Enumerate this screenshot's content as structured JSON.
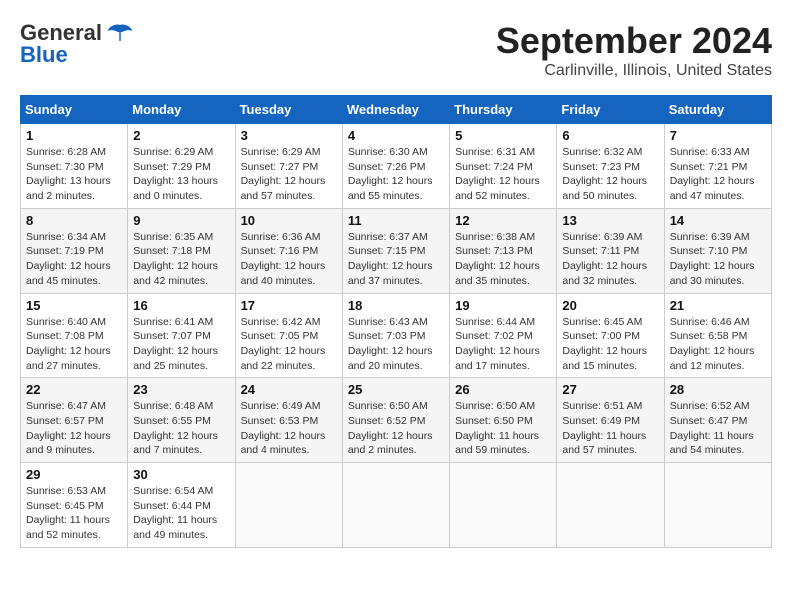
{
  "header": {
    "logo_line1": "General",
    "logo_line2": "Blue",
    "title": "September 2024",
    "subtitle": "Carlinville, Illinois, United States"
  },
  "columns": [
    "Sunday",
    "Monday",
    "Tuesday",
    "Wednesday",
    "Thursday",
    "Friday",
    "Saturday"
  ],
  "weeks": [
    [
      {
        "day": "1",
        "info": "Sunrise: 6:28 AM\nSunset: 7:30 PM\nDaylight: 13 hours\nand 2 minutes."
      },
      {
        "day": "2",
        "info": "Sunrise: 6:29 AM\nSunset: 7:29 PM\nDaylight: 13 hours\nand 0 minutes."
      },
      {
        "day": "3",
        "info": "Sunrise: 6:29 AM\nSunset: 7:27 PM\nDaylight: 12 hours\nand 57 minutes."
      },
      {
        "day": "4",
        "info": "Sunrise: 6:30 AM\nSunset: 7:26 PM\nDaylight: 12 hours\nand 55 minutes."
      },
      {
        "day": "5",
        "info": "Sunrise: 6:31 AM\nSunset: 7:24 PM\nDaylight: 12 hours\nand 52 minutes."
      },
      {
        "day": "6",
        "info": "Sunrise: 6:32 AM\nSunset: 7:23 PM\nDaylight: 12 hours\nand 50 minutes."
      },
      {
        "day": "7",
        "info": "Sunrise: 6:33 AM\nSunset: 7:21 PM\nDaylight: 12 hours\nand 47 minutes."
      }
    ],
    [
      {
        "day": "8",
        "info": "Sunrise: 6:34 AM\nSunset: 7:19 PM\nDaylight: 12 hours\nand 45 minutes."
      },
      {
        "day": "9",
        "info": "Sunrise: 6:35 AM\nSunset: 7:18 PM\nDaylight: 12 hours\nand 42 minutes."
      },
      {
        "day": "10",
        "info": "Sunrise: 6:36 AM\nSunset: 7:16 PM\nDaylight: 12 hours\nand 40 minutes."
      },
      {
        "day": "11",
        "info": "Sunrise: 6:37 AM\nSunset: 7:15 PM\nDaylight: 12 hours\nand 37 minutes."
      },
      {
        "day": "12",
        "info": "Sunrise: 6:38 AM\nSunset: 7:13 PM\nDaylight: 12 hours\nand 35 minutes."
      },
      {
        "day": "13",
        "info": "Sunrise: 6:39 AM\nSunset: 7:11 PM\nDaylight: 12 hours\nand 32 minutes."
      },
      {
        "day": "14",
        "info": "Sunrise: 6:39 AM\nSunset: 7:10 PM\nDaylight: 12 hours\nand 30 minutes."
      }
    ],
    [
      {
        "day": "15",
        "info": "Sunrise: 6:40 AM\nSunset: 7:08 PM\nDaylight: 12 hours\nand 27 minutes."
      },
      {
        "day": "16",
        "info": "Sunrise: 6:41 AM\nSunset: 7:07 PM\nDaylight: 12 hours\nand 25 minutes."
      },
      {
        "day": "17",
        "info": "Sunrise: 6:42 AM\nSunset: 7:05 PM\nDaylight: 12 hours\nand 22 minutes."
      },
      {
        "day": "18",
        "info": "Sunrise: 6:43 AM\nSunset: 7:03 PM\nDaylight: 12 hours\nand 20 minutes."
      },
      {
        "day": "19",
        "info": "Sunrise: 6:44 AM\nSunset: 7:02 PM\nDaylight: 12 hours\nand 17 minutes."
      },
      {
        "day": "20",
        "info": "Sunrise: 6:45 AM\nSunset: 7:00 PM\nDaylight: 12 hours\nand 15 minutes."
      },
      {
        "day": "21",
        "info": "Sunrise: 6:46 AM\nSunset: 6:58 PM\nDaylight: 12 hours\nand 12 minutes."
      }
    ],
    [
      {
        "day": "22",
        "info": "Sunrise: 6:47 AM\nSunset: 6:57 PM\nDaylight: 12 hours\nand 9 minutes."
      },
      {
        "day": "23",
        "info": "Sunrise: 6:48 AM\nSunset: 6:55 PM\nDaylight: 12 hours\nand 7 minutes."
      },
      {
        "day": "24",
        "info": "Sunrise: 6:49 AM\nSunset: 6:53 PM\nDaylight: 12 hours\nand 4 minutes."
      },
      {
        "day": "25",
        "info": "Sunrise: 6:50 AM\nSunset: 6:52 PM\nDaylight: 12 hours\nand 2 minutes."
      },
      {
        "day": "26",
        "info": "Sunrise: 6:50 AM\nSunset: 6:50 PM\nDaylight: 11 hours\nand 59 minutes."
      },
      {
        "day": "27",
        "info": "Sunrise: 6:51 AM\nSunset: 6:49 PM\nDaylight: 11 hours\nand 57 minutes."
      },
      {
        "day": "28",
        "info": "Sunrise: 6:52 AM\nSunset: 6:47 PM\nDaylight: 11 hours\nand 54 minutes."
      }
    ],
    [
      {
        "day": "29",
        "info": "Sunrise: 6:53 AM\nSunset: 6:45 PM\nDaylight: 11 hours\nand 52 minutes."
      },
      {
        "day": "30",
        "info": "Sunrise: 6:54 AM\nSunset: 6:44 PM\nDaylight: 11 hours\nand 49 minutes."
      },
      null,
      null,
      null,
      null,
      null
    ]
  ]
}
